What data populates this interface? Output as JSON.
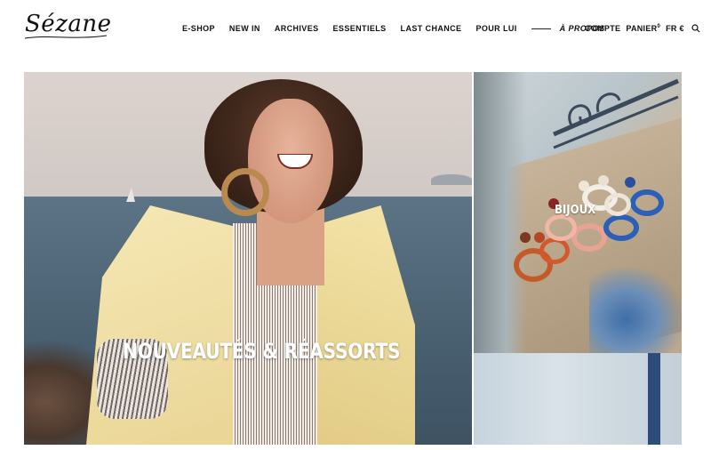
{
  "brand": {
    "logo_text": "Sézane"
  },
  "nav": {
    "items": [
      "E-SHOP",
      "NEW IN",
      "ARCHIVES",
      "ESSENTIELS",
      "LAST CHANCE",
      "POUR LUI"
    ],
    "apropos": "À PROPOS"
  },
  "account": {
    "compte": "COMPTE",
    "panier": "PANIER",
    "panier_count": "0",
    "locale": "FR €",
    "search_icon": "search-icon"
  },
  "hero": {
    "title": "NOUVEAUTÉS & RÉASSORTS"
  },
  "side": {
    "title": "BIJOUX"
  },
  "colors": {
    "text": "#111111",
    "overlay_text": "#ffffff"
  }
}
